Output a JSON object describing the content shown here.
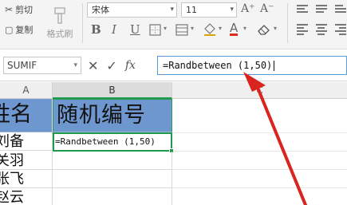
{
  "ribbon": {
    "cut_label": "剪切",
    "copy_label": "复制",
    "format_painter_label": "格式刷",
    "font_name": "宋体",
    "font_size": "11",
    "grow_font": "A⁺",
    "shrink_font": "A⁻",
    "bold": "B",
    "italic": "I",
    "underline": "U",
    "font_color_glyph": "A"
  },
  "formula_bar": {
    "name_box": "SUMIF",
    "cancel_glyph": "✕",
    "confirm_glyph": "✓",
    "fx_label": "fx",
    "formula": "=Randbetween (1,50)"
  },
  "grid": {
    "columns": [
      "A",
      "B",
      "C"
    ],
    "selected_column": "B",
    "header_row": {
      "a": "姓名",
      "b": "随机编号"
    },
    "rows": [
      {
        "name": "刘备",
        "number_formula": "=Randbetween (1,50)"
      },
      {
        "name": "关羽",
        "number_formula": ""
      },
      {
        "name": "张飞",
        "number_formula": ""
      },
      {
        "name": "赵云",
        "number_formula": ""
      }
    ]
  },
  "colors": {
    "header_fill": "#6f97cf",
    "selection_border": "#1d9a4b",
    "annotation_arrow": "#d9241f"
  }
}
